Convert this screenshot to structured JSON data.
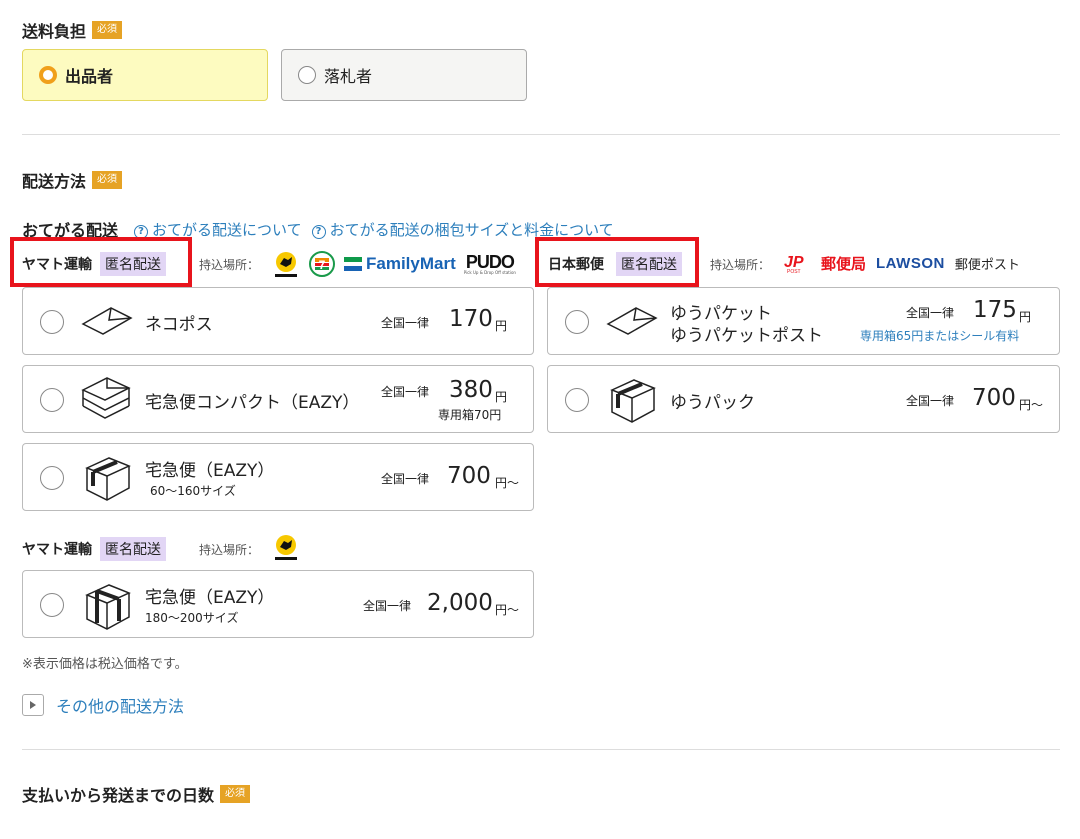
{
  "shipping_payer": {
    "title": "送料負担",
    "required": "必須",
    "options": [
      "出品者",
      "落札者"
    ],
    "selected": "出品者"
  },
  "shipping_method": {
    "title": "配送方法",
    "required": "必須",
    "otegaru": {
      "label": "おてがる配送",
      "link_about": "おてがる配送について",
      "link_size": "おてがる配送の梱包サイズと料金について"
    },
    "yamato": {
      "carrier": "ヤマト運輸",
      "anonymous": "匿名配送",
      "dropoff_label": "持込場所：",
      "logos": [
        "ヤマト運輸",
        "FamilyMart",
        "PUDO"
      ],
      "options": [
        {
          "name": "ネコポス",
          "flat": "全国一律",
          "price": "170",
          "unit": "円"
        },
        {
          "name": "宅急便コンパクト（EAZY）",
          "flat": "全国一律",
          "price": "380",
          "unit": "円",
          "note": "専用箱70円"
        },
        {
          "name": "宅急便（EAZY）",
          "sub": "60〜160サイズ",
          "flat": "全国一律",
          "price": "700",
          "unit": "円〜"
        }
      ]
    },
    "japanpost": {
      "carrier": "日本郵便",
      "anonymous": "匿名配送",
      "dropoff_label": "持込場所：",
      "logos": [
        "郵便局",
        "LAWSON",
        "郵便ポスト"
      ],
      "options": [
        {
          "name": "ゆうパケット",
          "name2": "ゆうパケットポスト",
          "flat": "全国一律",
          "price": "175",
          "unit": "円",
          "note": "専用箱65円またはシール有料"
        },
        {
          "name": "ゆうパック",
          "flat": "全国一律",
          "price": "700",
          "unit": "円〜"
        }
      ]
    },
    "yamato_large": {
      "carrier": "ヤマト運輸",
      "anonymous": "匿名配送",
      "dropoff_label": "持込場所：",
      "options": [
        {
          "name": "宅急便（EAZY）",
          "sub": "180〜200サイズ",
          "flat": "全国一律",
          "price": "2,000",
          "unit": "円〜"
        }
      ]
    },
    "tax_note": "※表示価格は税込価格です。",
    "other_methods": "その他の配送方法"
  },
  "days_to_ship": {
    "title": "支払いから発送までの日数",
    "required": "必須"
  },
  "colors": {
    "required_badge": "#e6a325",
    "selected_bg": "#fdfbc0",
    "anonymous_bg": "#e2d6f5",
    "link": "#2d7fbc",
    "highlight_red": "#e8141c"
  }
}
